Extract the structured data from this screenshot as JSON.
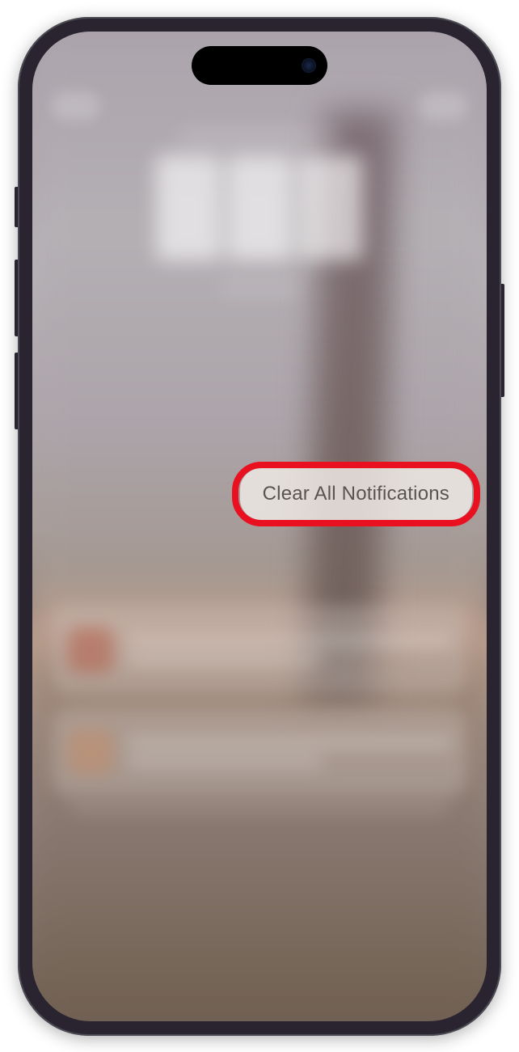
{
  "device": "iPhone",
  "screen": "lock-screen-notification-center",
  "clear_button": {
    "label": "Clear All Notifications"
  },
  "annotation": {
    "highlighted_element": "clear-all-notifications-button",
    "highlight_color": "#e91020"
  }
}
